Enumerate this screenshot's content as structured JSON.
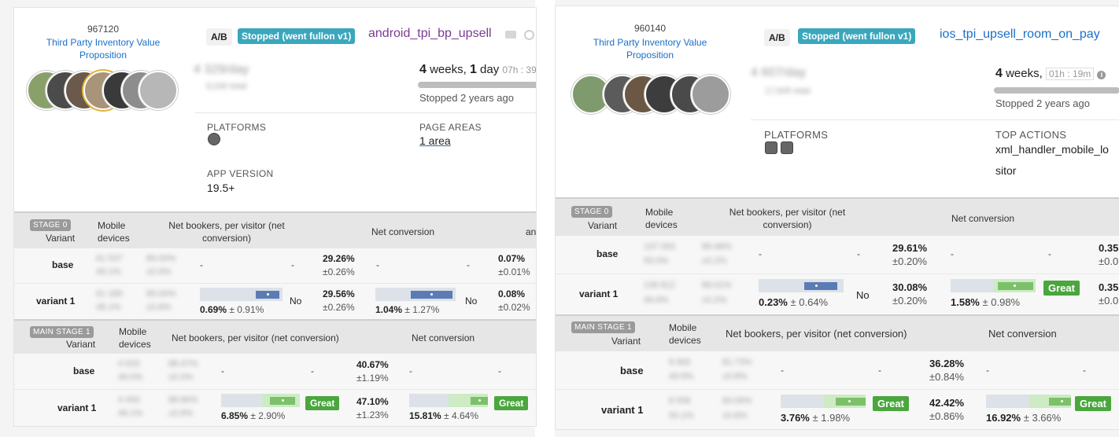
{
  "panels": [
    {
      "id": "967120",
      "team_name": "Third Party Inventory Value Proposition",
      "type_badge": "A/B",
      "status": "Stopped (went fullon v1)",
      "title": "android_tpi_bp_upsell",
      "title_color": "#7b3a94",
      "visitors_blur": "4 329/day",
      "visitors_sub_blur": "9,030 total",
      "duration": {
        "weeks": "4",
        "weeks_label": "weeks,",
        "days": "1",
        "days_label": "day",
        "rest": "07h : 39"
      },
      "stopped": "Stopped 2 years ago",
      "platforms_label": "PLATFORMS",
      "col2_label": "PAGE AREAS",
      "col2_value": "1 area",
      "app_version_label": "APP VERSION",
      "app_version": "19.5+",
      "stages": [
        {
          "badge": "STAGE 0",
          "variant_label": "Variant",
          "devices_label": "Mobile devices",
          "metric1": "Net bookers, per visitor (net conversion)",
          "metric2": "Net conversion",
          "metric3": "an",
          "rows": [
            {
              "name": "base",
              "b1": "61 537",
              "b2": "89.00%",
              "b3": "49.1%",
              "b4": "±0.9%",
              "m1": "-",
              "m1b": "-",
              "v1": "29.26%",
              "p1": "±0.26%",
              "m2": "-",
              "m2b": "-",
              "v2": "0.07%",
              "p2": "±0.01%"
            },
            {
              "name": "variant 1",
              "b1": "61 189",
              "b2": "89.00%",
              "b3": "48.1%",
              "b4": "±0.8%",
              "ci1": "0.69%",
              "ci1pm": "± 0.91%",
              "sig1": "No",
              "v1": "29.56%",
              "p1": "±0.26%",
              "ci2": "1.04%",
              "ci2pm": "± 1.27%",
              "sig2": "No",
              "v2": "0.08%",
              "p2": "±0.02%"
            }
          ]
        },
        {
          "badge": "MAIN STAGE 1",
          "variant_label": "Variant",
          "devices_label": "Mobile devices",
          "metric1": "Net bookers, per visitor (net conversion)",
          "metric2": "Net conversion",
          "rows": [
            {
              "name": "base",
              "b1": "4 633",
              "b2": "88.47%",
              "b3": "49.0%",
              "b4": "±0.0%",
              "m1": "-",
              "m1b": "-",
              "v1": "40.67%",
              "p1": "±1.19%",
              "m2": "-",
              "m2b": "-"
            },
            {
              "name": "variant 1",
              "b1": "4 493",
              "b2": "88.66%",
              "b3": "48.1%",
              "b4": "±0.8%",
              "ci1": "6.85%",
              "ci1pm": "± 2.90%",
              "sig1": "Great",
              "v1": "47.10%",
              "p1": "±1.23%",
              "ci2": "15.81%",
              "ci2pm": "± 4.64%",
              "sig2": "Great"
            }
          ]
        }
      ]
    },
    {
      "id": "960140",
      "team_name": "Third Party Inventory Value Proposition",
      "type_badge": "A/B",
      "status": "Stopped (went fullon v1)",
      "title": "ios_tpi_upsell_room_on_pay",
      "title_color": "#1a6fc9",
      "visitors_blur": "4 607/day",
      "visitors_sub_blur": "17,845 total",
      "duration": {
        "weeks": "4",
        "weeks_label": "weeks,",
        "rest": "01h : 19m"
      },
      "stopped": "Stopped 2 years ago",
      "platforms_label": "PLATFORMS",
      "col2_label": "TOP ACTIONS",
      "col2_value": "xml_handler_mobile_lo",
      "col2_value2": "sitor",
      "stages": [
        {
          "badge": "STAGE 0",
          "variant_label": "Variant",
          "devices_label": "Mobile devices",
          "metric1": "Net bookers, per visitor (net conversion)",
          "metric2": "Net conversion",
          "rows": [
            {
              "name": "base",
              "b1": "137 093",
              "b2": "89.48%",
              "b3": "50.0%",
              "b4": "±0.2%",
              "m1": "-",
              "m1b": "-",
              "v1": "29.61%",
              "p1": "±0.20%",
              "m2": "-",
              "m2b": "-",
              "v2": "0.35",
              "p2": "±0.0"
            },
            {
              "name": "variant 1",
              "b1": "136 812",
              "b2": "89.01%",
              "b3": "49.9%",
              "b4": "±0.2%",
              "ci1": "0.23%",
              "ci1pm": "± 0.64%",
              "sig1": "No",
              "v1": "30.08%",
              "p1": "±0.20%",
              "ci2": "1.58%",
              "ci2pm": "± 0.98%",
              "sig2": "Great",
              "v2": "0.35",
              "p2": "±0.0"
            }
          ]
        },
        {
          "badge": "MAIN STAGE 1",
          "variant_label": "Variant",
          "devices_label": "Mobile devices",
          "metric1": "Net bookers, per visitor (net conversion)",
          "metric2": "Net conversion",
          "rows": [
            {
              "name": "base",
              "b1": "8 900",
              "b2": "81.73%",
              "b3": "49.9%",
              "b4": "±0.8%",
              "m1": "-",
              "m1b": "-",
              "v1": "36.28%",
              "p1": "±0.84%",
              "m2": "-",
              "m2b": "-"
            },
            {
              "name": "variant 1",
              "b1": "8 936",
              "b2": "84.06%",
              "b3": "50.1%",
              "b4": "±0.8%",
              "ci1": "3.76%",
              "ci1pm": "± 1.98%",
              "sig1": "Great",
              "v1": "42.42%",
              "p1": "±0.86%",
              "ci2": "16.92%",
              "ci2pm": "± 3.66%",
              "sig2": "Great"
            }
          ]
        }
      ]
    }
  ]
}
